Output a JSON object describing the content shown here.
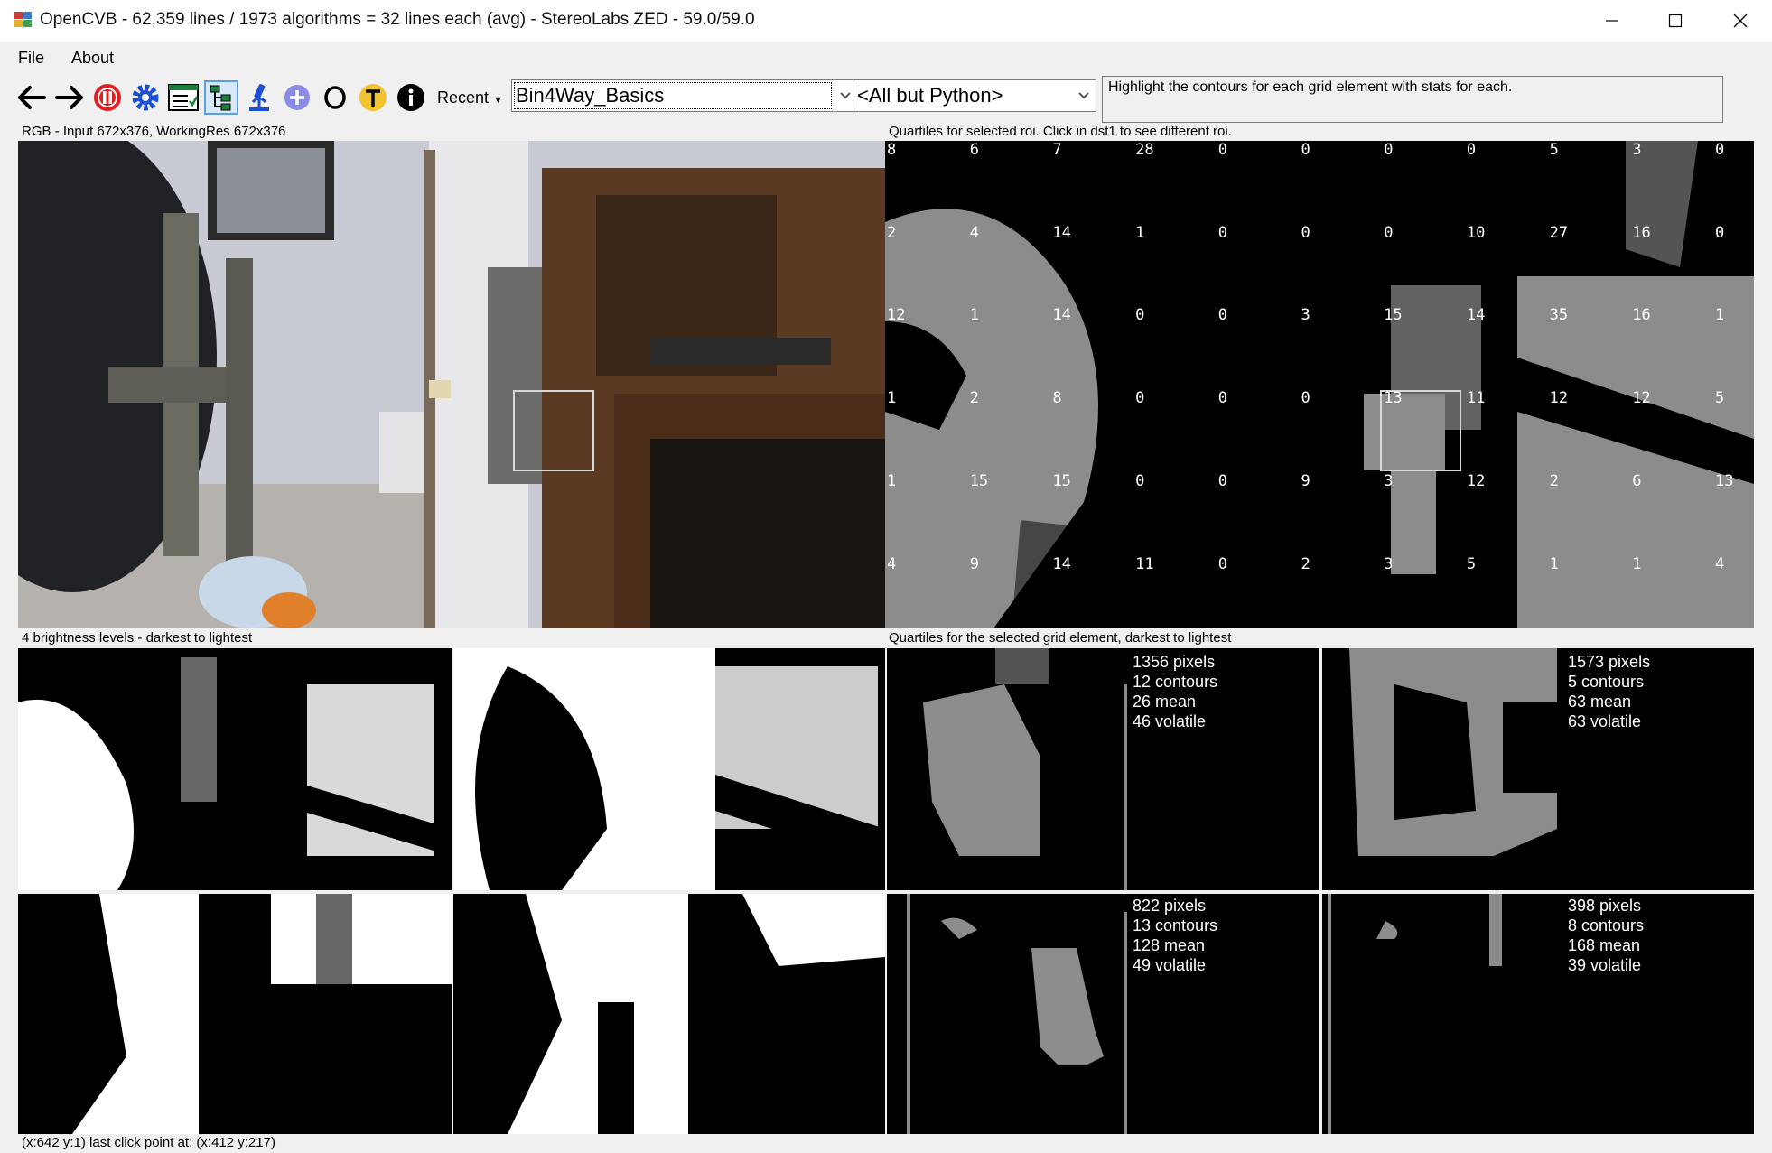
{
  "window": {
    "title": "OpenCVB - 62,359 lines / 1973 algorithms = 32 lines each (avg) - StereoLabs ZED - 59.0/59.0"
  },
  "menu": [
    {
      "label": "File"
    },
    {
      "label": "About"
    }
  ],
  "toolbar": {
    "buttons": [
      {
        "icon": "back-arrow-icon"
      },
      {
        "icon": "forward-arrow-icon"
      },
      {
        "icon": "pause-icon"
      },
      {
        "icon": "settings-gear-icon"
      },
      {
        "icon": "test-all-icon"
      },
      {
        "icon": "tree-view-icon"
      },
      {
        "icon": "microscope-icon"
      },
      {
        "icon": "plus-circle-icon"
      },
      {
        "icon": "opengl-icon"
      },
      {
        "icon": "translate-icon"
      },
      {
        "icon": "info-icon"
      }
    ],
    "recent_label": "Recent",
    "algorithm_value": "Bin4Way_Basics",
    "group_value": "<All but Python>",
    "description": "Highlight the contours for each grid element with stats for each."
  },
  "labels": {
    "rgb": "RGB - Input 672x376, WorkingRes 672x376",
    "quartiles_roi": "Quartiles for selected roi.  Click in dst1 to see different roi.",
    "brightness": "4 brightness levels - darkest to lightest",
    "quartiles_grid": "Quartiles for the selected grid element, darkest to lightest"
  },
  "grid_numbers": [
    [
      "8",
      "6",
      "7",
      "28",
      "0",
      "0",
      "0",
      "0",
      "5",
      "3",
      "0"
    ],
    [
      "2",
      "4",
      "14",
      "1",
      "0",
      "0",
      "0",
      "10",
      "27",
      "16",
      "0"
    ],
    [
      "12",
      "1",
      "14",
      "0",
      "0",
      "3",
      "15",
      "14",
      "35",
      "16",
      "1"
    ],
    [
      "1",
      "2",
      "8",
      "0",
      "0",
      "0",
      "13",
      "11",
      "12",
      "12",
      "5"
    ],
    [
      "1",
      "15",
      "15",
      "0",
      "0",
      "9",
      "3",
      "12",
      "2",
      "6",
      "13"
    ],
    [
      "4",
      "9",
      "14",
      "11",
      "0",
      "2",
      "3",
      "5",
      "1",
      "1",
      "4"
    ]
  ],
  "stats": [
    {
      "pixels": "1356 pixels",
      "contours": "12 contours",
      "mean": "26 mean",
      "volatile": "46 volatile"
    },
    {
      "pixels": "1573 pixels",
      "contours": "5 contours",
      "mean": "63 mean",
      "volatile": "63 volatile"
    },
    {
      "pixels": "822 pixels",
      "contours": "13 contours",
      "mean": "128 mean",
      "volatile": "49 volatile"
    },
    {
      "pixels": "398 pixels",
      "contours": "8 contours",
      "mean": "168 mean",
      "volatile": "39 volatile"
    }
  ],
  "status": "(x:642 y:1) last click point at: (x:412 y:217)",
  "colors": {
    "gray_level": "#8c8c8c",
    "accent": "#5aa0e6",
    "pause_red": "#e02020",
    "gear_blue": "#1a4fd6"
  }
}
